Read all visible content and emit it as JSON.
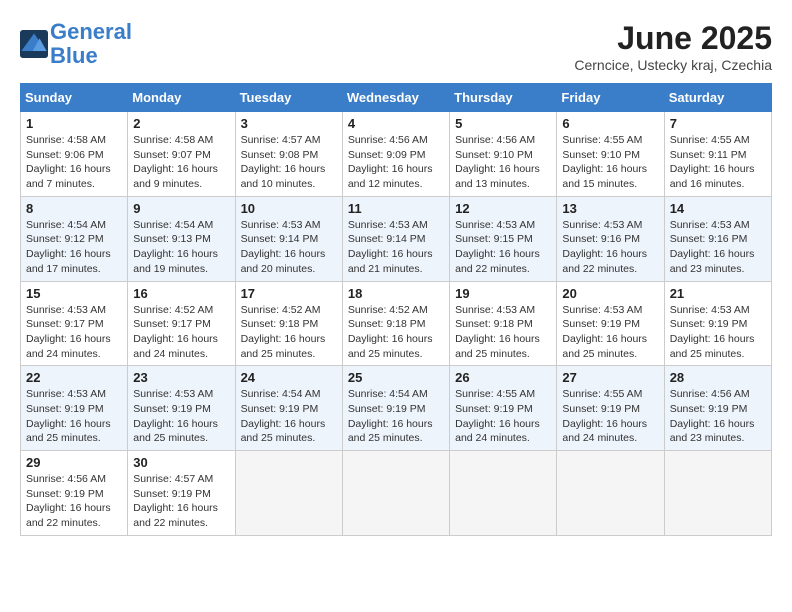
{
  "logo": {
    "line1": "General",
    "line2": "Blue"
  },
  "title": "June 2025",
  "subtitle": "Cerncice, Ustecky kraj, Czechia",
  "weekdays": [
    "Sunday",
    "Monday",
    "Tuesday",
    "Wednesday",
    "Thursday",
    "Friday",
    "Saturday"
  ],
  "weeks": [
    {
      "even": false,
      "days": [
        {
          "num": "1",
          "sunrise": "4:58 AM",
          "sunset": "9:06 PM",
          "daylight": "16 hours and 7 minutes."
        },
        {
          "num": "2",
          "sunrise": "4:58 AM",
          "sunset": "9:07 PM",
          "daylight": "16 hours and 9 minutes."
        },
        {
          "num": "3",
          "sunrise": "4:57 AM",
          "sunset": "9:08 PM",
          "daylight": "16 hours and 10 minutes."
        },
        {
          "num": "4",
          "sunrise": "4:56 AM",
          "sunset": "9:09 PM",
          "daylight": "16 hours and 12 minutes."
        },
        {
          "num": "5",
          "sunrise": "4:56 AM",
          "sunset": "9:10 PM",
          "daylight": "16 hours and 13 minutes."
        },
        {
          "num": "6",
          "sunrise": "4:55 AM",
          "sunset": "9:10 PM",
          "daylight": "16 hours and 15 minutes."
        },
        {
          "num": "7",
          "sunrise": "4:55 AM",
          "sunset": "9:11 PM",
          "daylight": "16 hours and 16 minutes."
        }
      ]
    },
    {
      "even": true,
      "days": [
        {
          "num": "8",
          "sunrise": "4:54 AM",
          "sunset": "9:12 PM",
          "daylight": "16 hours and 17 minutes."
        },
        {
          "num": "9",
          "sunrise": "4:54 AM",
          "sunset": "9:13 PM",
          "daylight": "16 hours and 19 minutes."
        },
        {
          "num": "10",
          "sunrise": "4:53 AM",
          "sunset": "9:14 PM",
          "daylight": "16 hours and 20 minutes."
        },
        {
          "num": "11",
          "sunrise": "4:53 AM",
          "sunset": "9:14 PM",
          "daylight": "16 hours and 21 minutes."
        },
        {
          "num": "12",
          "sunrise": "4:53 AM",
          "sunset": "9:15 PM",
          "daylight": "16 hours and 22 minutes."
        },
        {
          "num": "13",
          "sunrise": "4:53 AM",
          "sunset": "9:16 PM",
          "daylight": "16 hours and 22 minutes."
        },
        {
          "num": "14",
          "sunrise": "4:53 AM",
          "sunset": "9:16 PM",
          "daylight": "16 hours and 23 minutes."
        }
      ]
    },
    {
      "even": false,
      "days": [
        {
          "num": "15",
          "sunrise": "4:53 AM",
          "sunset": "9:17 PM",
          "daylight": "16 hours and 24 minutes."
        },
        {
          "num": "16",
          "sunrise": "4:52 AM",
          "sunset": "9:17 PM",
          "daylight": "16 hours and 24 minutes."
        },
        {
          "num": "17",
          "sunrise": "4:52 AM",
          "sunset": "9:18 PM",
          "daylight": "16 hours and 25 minutes."
        },
        {
          "num": "18",
          "sunrise": "4:52 AM",
          "sunset": "9:18 PM",
          "daylight": "16 hours and 25 minutes."
        },
        {
          "num": "19",
          "sunrise": "4:53 AM",
          "sunset": "9:18 PM",
          "daylight": "16 hours and 25 minutes."
        },
        {
          "num": "20",
          "sunrise": "4:53 AM",
          "sunset": "9:19 PM",
          "daylight": "16 hours and 25 minutes."
        },
        {
          "num": "21",
          "sunrise": "4:53 AM",
          "sunset": "9:19 PM",
          "daylight": "16 hours and 25 minutes."
        }
      ]
    },
    {
      "even": true,
      "days": [
        {
          "num": "22",
          "sunrise": "4:53 AM",
          "sunset": "9:19 PM",
          "daylight": "16 hours and 25 minutes."
        },
        {
          "num": "23",
          "sunrise": "4:53 AM",
          "sunset": "9:19 PM",
          "daylight": "16 hours and 25 minutes."
        },
        {
          "num": "24",
          "sunrise": "4:54 AM",
          "sunset": "9:19 PM",
          "daylight": "16 hours and 25 minutes."
        },
        {
          "num": "25",
          "sunrise": "4:54 AM",
          "sunset": "9:19 PM",
          "daylight": "16 hours and 25 minutes."
        },
        {
          "num": "26",
          "sunrise": "4:55 AM",
          "sunset": "9:19 PM",
          "daylight": "16 hours and 24 minutes."
        },
        {
          "num": "27",
          "sunrise": "4:55 AM",
          "sunset": "9:19 PM",
          "daylight": "16 hours and 24 minutes."
        },
        {
          "num": "28",
          "sunrise": "4:56 AM",
          "sunset": "9:19 PM",
          "daylight": "16 hours and 23 minutes."
        }
      ]
    },
    {
      "even": false,
      "days": [
        {
          "num": "29",
          "sunrise": "4:56 AM",
          "sunset": "9:19 PM",
          "daylight": "16 hours and 22 minutes."
        },
        {
          "num": "30",
          "sunrise": "4:57 AM",
          "sunset": "9:19 PM",
          "daylight": "16 hours and 22 minutes."
        },
        null,
        null,
        null,
        null,
        null
      ]
    }
  ]
}
